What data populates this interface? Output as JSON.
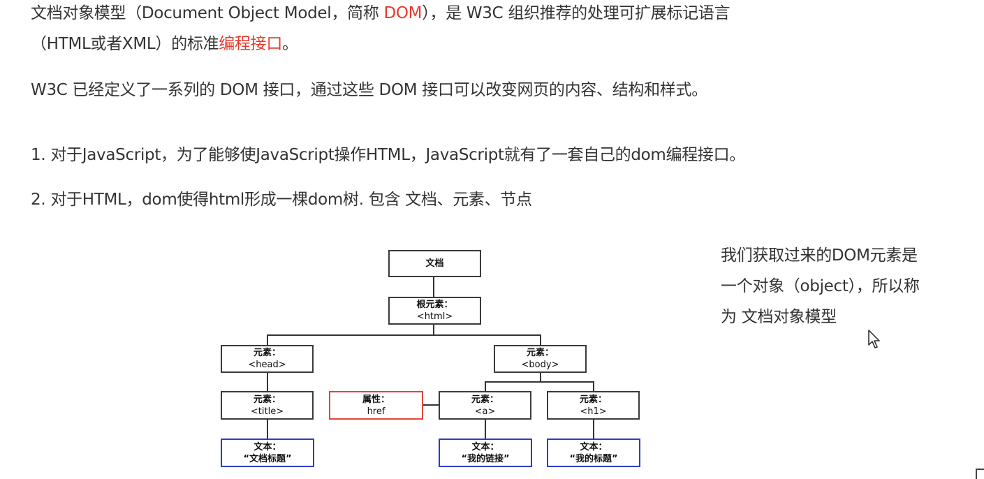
{
  "intro": {
    "line1_before": "文档对象模型（Document Object Model，简称 ",
    "line1_highlight": "DOM",
    "line1_after": "），是 W3C 组织推荐的处理可扩展标记语言",
    "line2_before": "（HTML或者XML）的标准",
    "line2_highlight": "编程接口",
    "line2_after": "。"
  },
  "paragraph_w3c": "W3C 已经定义了一系列的 DOM 接口，通过这些 DOM 接口可以改变网页的内容、结构和样式。",
  "points": [
    "1. 对于JavaScript，为了能够使JavaScript操作HTML，JavaScript就有了一套自己的dom编程接口。",
    "2. 对于HTML，dom使得html形成一棵dom树. 包含 文档、元素、节点"
  ],
  "side_note": {
    "line1": "我们获取过来的DOM元素是",
    "line2": "一个对象（object），所以称",
    "line3": "为 文档对象模型"
  },
  "tree": {
    "document": {
      "label": "文档"
    },
    "root": {
      "label": "根元素：",
      "tag": "<html>"
    },
    "head": {
      "label": "元素：",
      "tag": "<head>"
    },
    "body": {
      "label": "元素：",
      "tag": "<body>"
    },
    "title": {
      "label": "元素：",
      "tag": "<title>"
    },
    "attr": {
      "label": "属性：",
      "tag": "href"
    },
    "a": {
      "label": "元素：",
      "tag": "<a>"
    },
    "h1": {
      "label": "元素：",
      "tag": "<h1>"
    },
    "text_title": {
      "label": "文本：",
      "value": "“文档标题”"
    },
    "text_a": {
      "label": "文本：",
      "value": "“我的链接”"
    },
    "text_h1": {
      "label": "文本：",
      "value": "“我的标题”"
    }
  },
  "colors": {
    "highlight": "#e83a2c",
    "attribute_border": "#e0463b",
    "text_node_border": "#2a3ec2",
    "element_border": "#3b3b3b"
  }
}
